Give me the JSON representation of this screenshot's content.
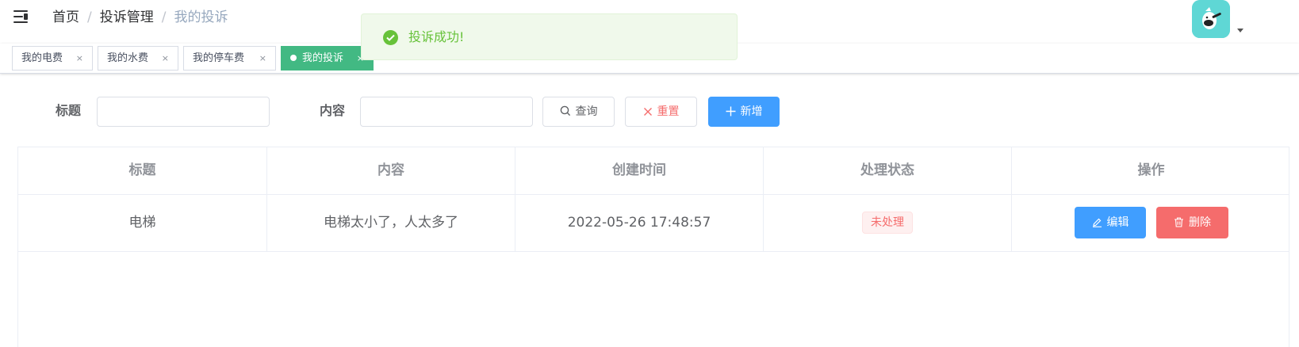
{
  "navbar": {
    "breadcrumb": [
      {
        "label": "首页"
      },
      {
        "label": "投诉管理"
      },
      {
        "label": "我的投诉"
      }
    ],
    "separator": "/"
  },
  "tabs": [
    {
      "label": "我的电费",
      "close": "×"
    },
    {
      "label": "我的水费",
      "close": "×"
    },
    {
      "label": "我的停车费",
      "close": "×"
    },
    {
      "label": "我的投诉",
      "close": "×",
      "active": true
    }
  ],
  "message": {
    "text": "投诉成功!",
    "type": "success"
  },
  "search": {
    "title_label": "标题",
    "title_value": "",
    "content_label": "内容",
    "content_value": "",
    "query_label": "查询",
    "reset_label": "重置",
    "add_label": "新增"
  },
  "table": {
    "columns": [
      "标题",
      "内容",
      "创建时间",
      "处理状态",
      "操作"
    ],
    "rows": [
      {
        "title": "电梯",
        "content": "电梯太小了，人太多了",
        "created": "2022-05-26 17:48:57",
        "status": "未处理",
        "edit_label": "编辑",
        "delete_label": "删除"
      }
    ]
  },
  "colors": {
    "primary": "#409eff",
    "danger": "#f56c6c",
    "success": "#67c23a",
    "active_tab": "#42b983"
  }
}
